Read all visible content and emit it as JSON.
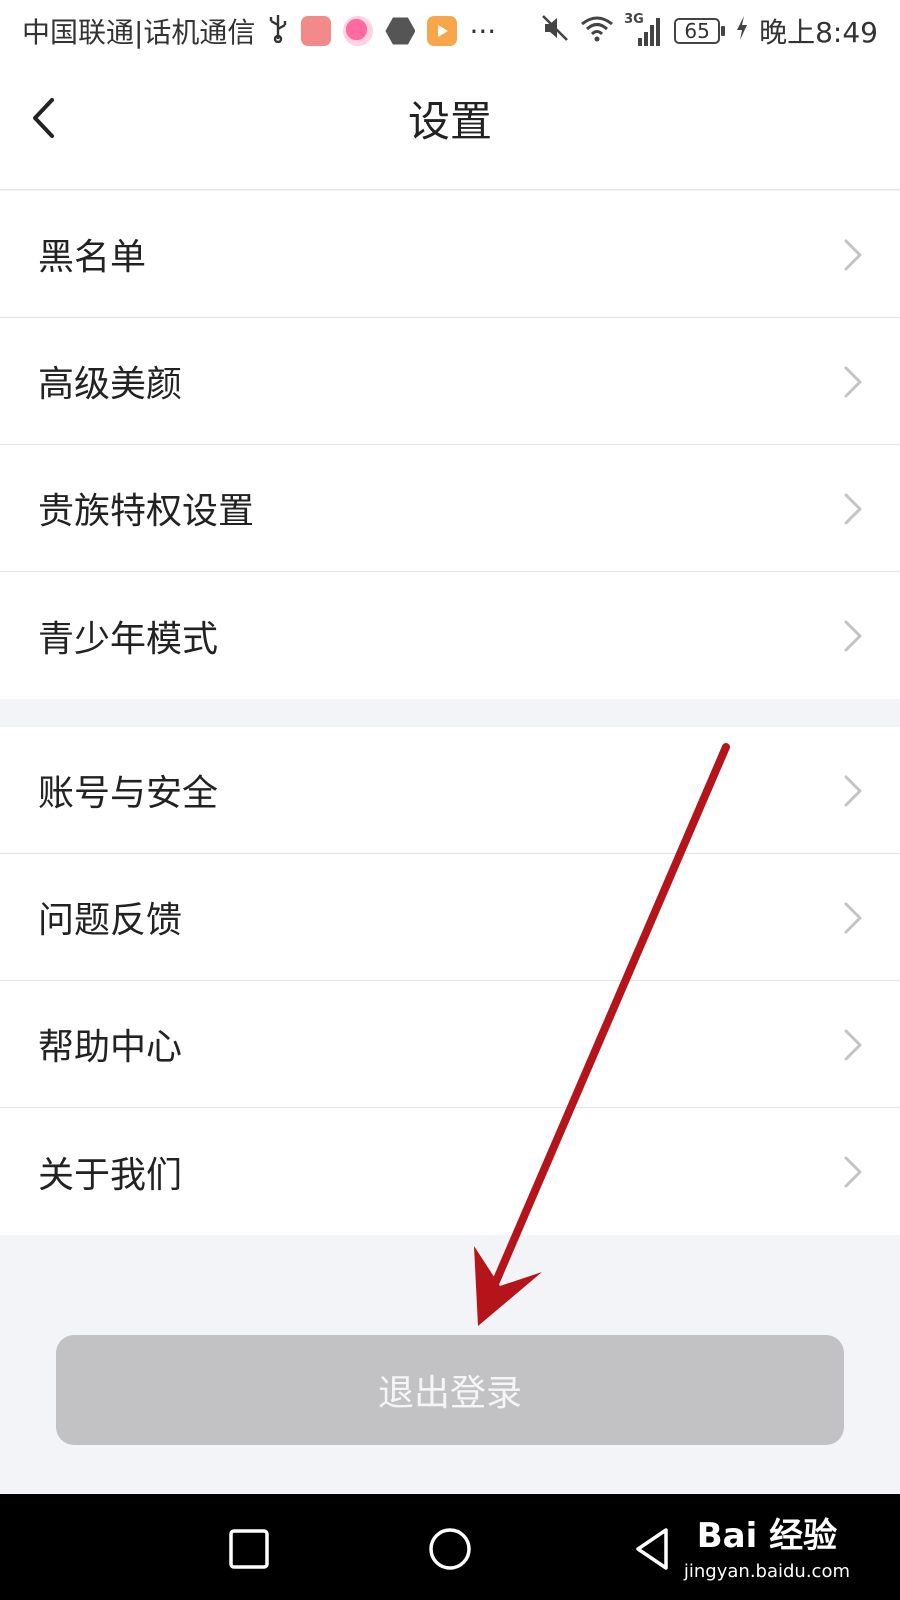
{
  "status_bar": {
    "carrier": "中国联通|话机通信",
    "overflow": "···",
    "network_type": "3G",
    "battery_level": "65",
    "time": "晚上8:49",
    "icons": [
      "usb-icon",
      "huawei-app-icon",
      "pink-app-icon",
      "hex-app-icon",
      "video-app-icon",
      "mute-icon",
      "wifi-icon",
      "signal-icon",
      "battery-icon",
      "charging-icon"
    ]
  },
  "header": {
    "title": "设置",
    "back_icon": "chevron-left-icon"
  },
  "settings_groups": [
    {
      "items": [
        {
          "label": "黑名单"
        },
        {
          "label": "高级美颜"
        },
        {
          "label": "贵族特权设置"
        },
        {
          "label": "青少年模式"
        }
      ]
    },
    {
      "items": [
        {
          "label": "账号与安全"
        },
        {
          "label": "问题反馈"
        },
        {
          "label": "帮助中心"
        },
        {
          "label": "关于我们"
        }
      ]
    }
  ],
  "logout_button": {
    "label": "退出登录"
  },
  "annotation": {
    "type": "arrow",
    "color": "#b5141a"
  },
  "watermark": {
    "brand": "Bai 经验",
    "url": "jingyan.baidu.com"
  },
  "colors": {
    "background": "#f3f4f8",
    "logout_button_bg": "#c2c1c4",
    "divider": "#e2e2e2",
    "chevron": "#c4c4c4"
  }
}
